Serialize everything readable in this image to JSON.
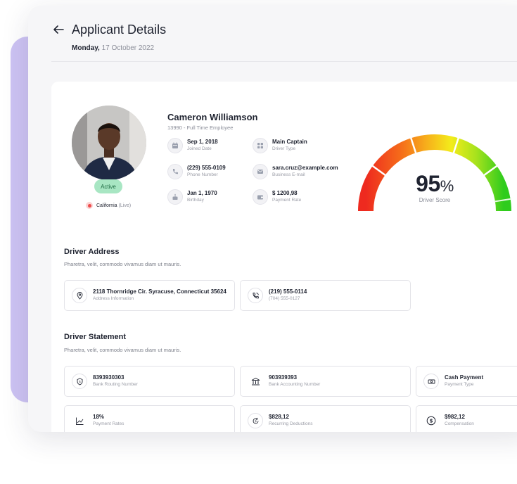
{
  "header": {
    "title": "Applicant Details",
    "date_day": "Monday,",
    "date_rest": "17 October 2022"
  },
  "profile": {
    "name": "Cameron Williamson",
    "subtitle": "13990 - Full Time Employee",
    "status": "Active",
    "location": "California",
    "location_note": "(Live)",
    "details": [
      {
        "value": "Sep 1, 2018",
        "label": "Joined Date",
        "icon": "calendar-icon"
      },
      {
        "value": "Main Captain",
        "label": "Driver Type",
        "icon": "grid-icon"
      },
      {
        "value": "(229) 555-0109",
        "label": "Phone Number",
        "icon": "phone-icon"
      },
      {
        "value": "sara.cruz@example.com",
        "label": "Business E-mail",
        "icon": "mail-icon"
      },
      {
        "value": "Jan 1, 1970",
        "label": "Birthday",
        "icon": "cake-icon"
      },
      {
        "value": "$ 1200,98",
        "label": "Payment Rate",
        "icon": "wallet-icon"
      }
    ]
  },
  "score": {
    "value": "95",
    "unit": "%",
    "label": "Driver Score",
    "fraction": 0.95
  },
  "address": {
    "title": "Driver Address",
    "desc": "Pharetra, velit, commodo vivamus diam ut mauris.",
    "items": [
      {
        "value": "2118 Thornridge Cir. Syracuse, Connecticut 35624",
        "label": "Address Information",
        "icon": "location-pin-icon"
      },
      {
        "value": "(219) 555-0114",
        "label": "(704) 555-0127",
        "icon": "phone-call-icon"
      }
    ]
  },
  "statement": {
    "title": "Driver Statement",
    "desc": "Pharetra, velit, commodo vivamus diam ut mauris.",
    "items": [
      {
        "value": "8393930303",
        "label": "Bank Routing Number",
        "icon": "bank-shield-icon"
      },
      {
        "value": "903939393",
        "label": "Bank Accounting Number",
        "icon": "bank-icon"
      },
      {
        "value": "Cash Payment",
        "label": "Payment Type",
        "icon": "cash-icon"
      },
      {
        "value": "18%",
        "label": "Payment Rates",
        "icon": "trend-icon"
      },
      {
        "value": "$828,12",
        "label": "Recurring Deductions",
        "icon": "recurring-icon"
      },
      {
        "value": "$982,12",
        "label": "Compensation",
        "icon": "dollar-icon"
      }
    ]
  },
  "colors": {
    "accent_purple": "#cdc3f3",
    "active_green": "#a8e6c3",
    "gauge_red": "#ee2a1f",
    "gauge_orange": "#f7a21b",
    "gauge_yellow": "#f3ec1b",
    "gauge_green": "#3fcf1d"
  }
}
